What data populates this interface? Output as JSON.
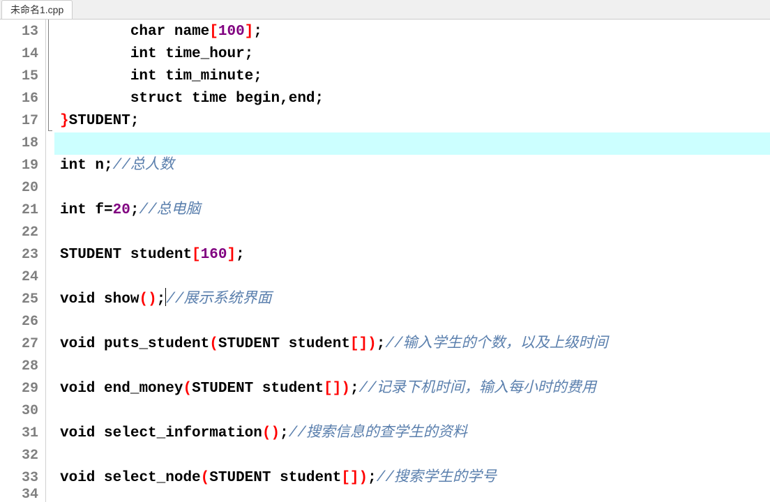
{
  "tab": {
    "filename": "未命名1.cpp"
  },
  "first_line_number": 13,
  "highlighted_index": 5,
  "lines": {
    "l13": {
      "indent": "        ",
      "kw": "char",
      "sp1": " ",
      "id": "name",
      "br1": "[",
      "num": "100",
      "br2": "]",
      "semi": ";"
    },
    "l14": {
      "indent": "        ",
      "kw": "int",
      "sp1": " ",
      "id": "time_hour",
      "semi": ";"
    },
    "l15": {
      "indent": "        ",
      "kw": "int",
      "sp1": " ",
      "id": "tim_minute",
      "semi": ";"
    },
    "l16": {
      "indent": "        ",
      "kw": "struct",
      "sp1": " ",
      "id1": "time",
      "sp2": " ",
      "id2": "begin",
      "comma": ",",
      "id3": "end",
      "semi": ";"
    },
    "l17": {
      "brace": "}",
      "id": "STUDENT",
      "semi": ";"
    },
    "l18": {
      "blank": ""
    },
    "l19": {
      "kw": "int",
      "sp1": " ",
      "id": "n",
      "semi": ";",
      "comment": "//总人数"
    },
    "l20": {
      "blank": ""
    },
    "l21": {
      "kw": "int",
      "sp1": " ",
      "id": "f",
      "eq": "=",
      "num": "20",
      "semi": ";",
      "comment": "//总电脑"
    },
    "l22": {
      "blank": ""
    },
    "l23": {
      "id1": "STUDENT",
      "sp1": " ",
      "id2": "student",
      "br1": "[",
      "num": "160",
      "br2": "]",
      "semi": ";"
    },
    "l24": {
      "blank": ""
    },
    "l25": {
      "kw": "void",
      "sp1": " ",
      "id": "show",
      "p1": "(",
      "p2": ")",
      "semi": ";",
      "comment": "//展示系统界面"
    },
    "l26": {
      "blank": ""
    },
    "l27": {
      "kw": "void",
      "sp1": " ",
      "id": "puts_student",
      "p1": "(",
      "arg_t": "STUDENT",
      "sp2": " ",
      "arg_n": "student",
      "br1": "[",
      "br2": "]",
      "p2": ")",
      "semi": ";",
      "comment": "//输入学生的个数，以及上级时间"
    },
    "l28": {
      "blank": ""
    },
    "l29": {
      "kw": "void",
      "sp1": " ",
      "id": "end_money",
      "p1": "(",
      "arg_t": "STUDENT",
      "sp2": " ",
      "arg_n": "student",
      "br1": "[",
      "br2": "]",
      "p2": ")",
      "semi": ";",
      "comment": "//记录下机时间，输入每小时的费用"
    },
    "l30": {
      "blank": ""
    },
    "l31": {
      "kw": "void",
      "sp1": " ",
      "id": "select_information",
      "p1": "(",
      "p2": ")",
      "semi": ";",
      "comment": "//搜索信息的查学生的资料"
    },
    "l32": {
      "blank": ""
    },
    "l33": {
      "kw": "void",
      "sp1": " ",
      "id": "select_node",
      "p1": "(",
      "arg_t": "STUDENT",
      "sp2": " ",
      "arg_n": "student",
      "br1": "[",
      "br2": "]",
      "p2": ")",
      "semi": ";",
      "comment": "//搜索学生的学号"
    },
    "l34": {
      "blank": ""
    }
  }
}
